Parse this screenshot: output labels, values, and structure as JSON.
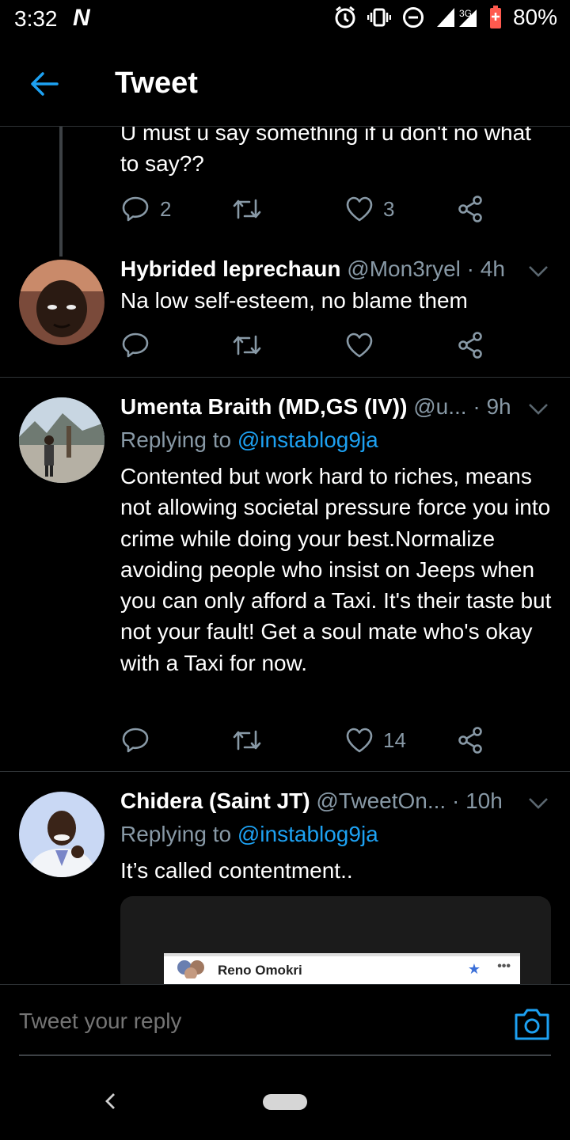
{
  "status_bar": {
    "time": "3:32",
    "carrier_glyph": "N",
    "network": "3G",
    "battery": "80%",
    "icons": [
      "alarm-icon",
      "vibrate-icon",
      "dnd-icon",
      "signal-icon",
      "battery-icon"
    ]
  },
  "header": {
    "back_icon": "arrow-left-icon",
    "title": "Tweet"
  },
  "tweets": [
    {
      "text": "U must u say something if u don't no what to say??",
      "reply_count": "2",
      "retweet_count": "",
      "like_count": "3"
    },
    {
      "name": "Hybrided leprechaun",
      "handle": "@Mon3ryel",
      "time": "· 4h",
      "text": "Na low self-esteem, no blame them",
      "reply_count": "",
      "retweet_count": "",
      "like_count": ""
    },
    {
      "name": "Umenta Braith (MD,GS (IV))",
      "handle": "@u...",
      "time": "· 9h",
      "replying_label": "Replying to ",
      "replying_to": "@instablog9ja",
      "text": "Contented but work hard to riches, means not allowing societal pressure force you into crime while doing your best.Normalize avoiding people who insist on Jeeps when you can only afford a Taxi. It's their taste but not your fault! Get a soul mate who's okay with a Taxi for now.",
      "reply_count": "",
      "retweet_count": "",
      "like_count": "14"
    },
    {
      "name": "Chidera (Saint JT)",
      "handle": "@TweetOn...",
      "time": "· 10h",
      "replying_label": "Replying to ",
      "replying_to": "@instablog9ja",
      "text": "It’s called contentment..",
      "embed_name": "Reno Omokri",
      "embed_star": "★",
      "embed_more": "•••"
    }
  ],
  "reply_bar": {
    "placeholder": "Tweet your reply",
    "camera_icon": "camera-icon"
  },
  "colors": {
    "background": "#000000",
    "text": "#ffffff",
    "muted": "#8899a6",
    "accent": "#1da1f2",
    "divider": "#2f3336"
  }
}
